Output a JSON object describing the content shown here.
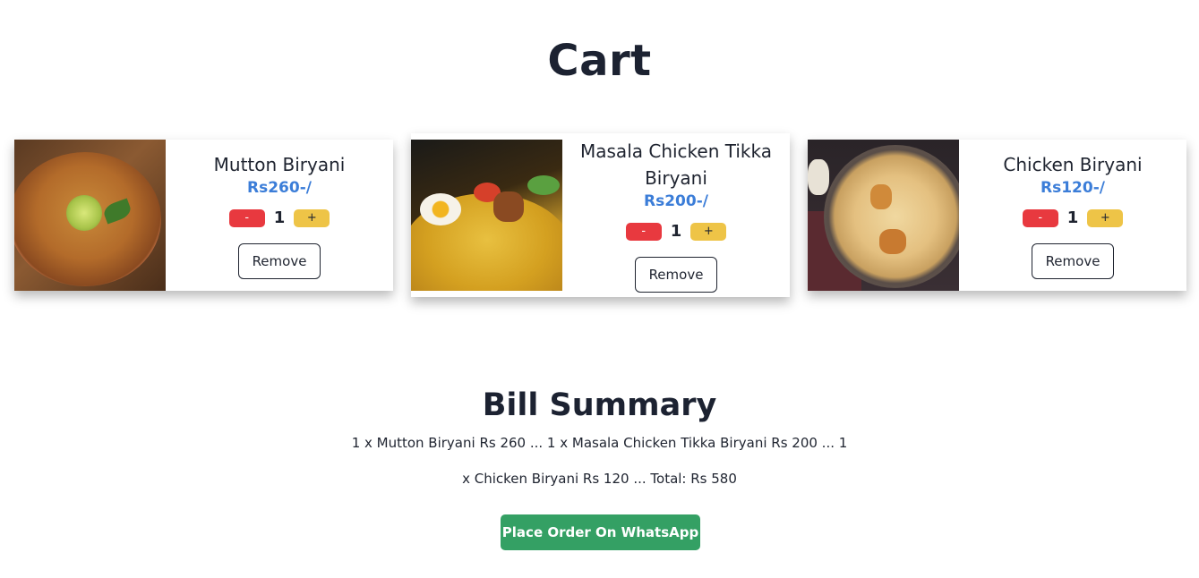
{
  "page": {
    "title": "Cart"
  },
  "cart": {
    "items": [
      {
        "name": "Mutton Biryani",
        "price": "Rs260-/",
        "qty": "1",
        "minus_label": "-",
        "plus_label": "+",
        "remove_label": "Remove"
      },
      {
        "name": "Masala Chicken Tikka Biryani",
        "price": "Rs200-/",
        "qty": "1",
        "minus_label": "-",
        "plus_label": "+",
        "remove_label": "Remove"
      },
      {
        "name": "Chicken Biryani",
        "price": "Rs120-/",
        "qty": "1",
        "minus_label": "-",
        "plus_label": "+",
        "remove_label": "Remove"
      }
    ]
  },
  "bill": {
    "title": "Bill Summary",
    "line1": "1 x Mutton Biryani Rs 260 ... 1 x Masala Chicken Tikka Biryani Rs 200 ... 1",
    "line2": "x Chicken Biryani Rs 120 ... Total: Rs 580",
    "order_button": "Place Order On WhatsApp"
  },
  "colors": {
    "price": "#3b7dd8",
    "minus": "#e8393f",
    "plus": "#eec447",
    "order": "#34a064"
  }
}
